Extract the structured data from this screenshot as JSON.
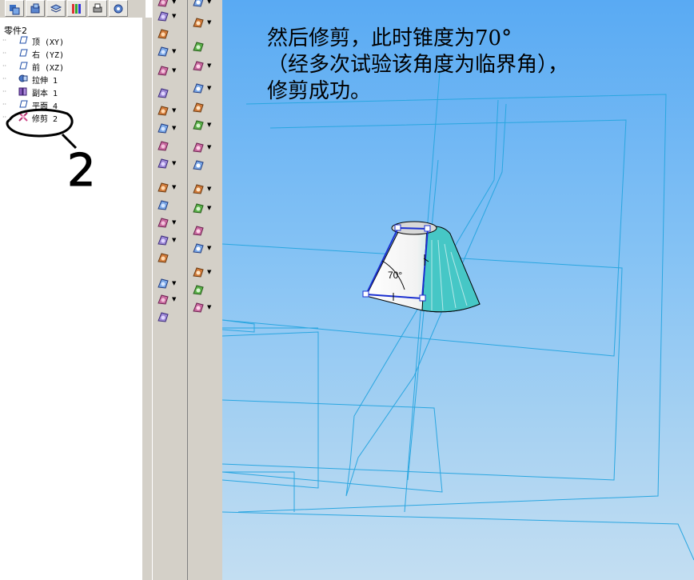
{
  "tree": {
    "root": "零件2",
    "items": [
      {
        "label": "顶 (XY)",
        "icon": "plane-icon"
      },
      {
        "label": "右 (YZ)",
        "icon": "plane-icon"
      },
      {
        "label": "前 (XZ)",
        "icon": "plane-icon"
      },
      {
        "label": "拉伸 1",
        "icon": "extrude-icon"
      },
      {
        "label": "副本 1",
        "icon": "copy-icon"
      },
      {
        "label": "平面 4",
        "icon": "plane-icon"
      },
      {
        "label": "修剪 2",
        "icon": "trim-icon"
      }
    ]
  },
  "annotation": {
    "line1": "然后修剪，此时锥度为70°",
    "line2": "（经多次试验该角度为临界角），",
    "line3": "修剪成功。"
  },
  "handwritten_number": "2",
  "model": {
    "angle_label": "70°"
  },
  "colors": {
    "viewport_top": "#59aaf3",
    "sketch_blue": "#1a2fd0",
    "construction_line": "#2aa6e0",
    "cone_teal": "#46c7c6"
  }
}
